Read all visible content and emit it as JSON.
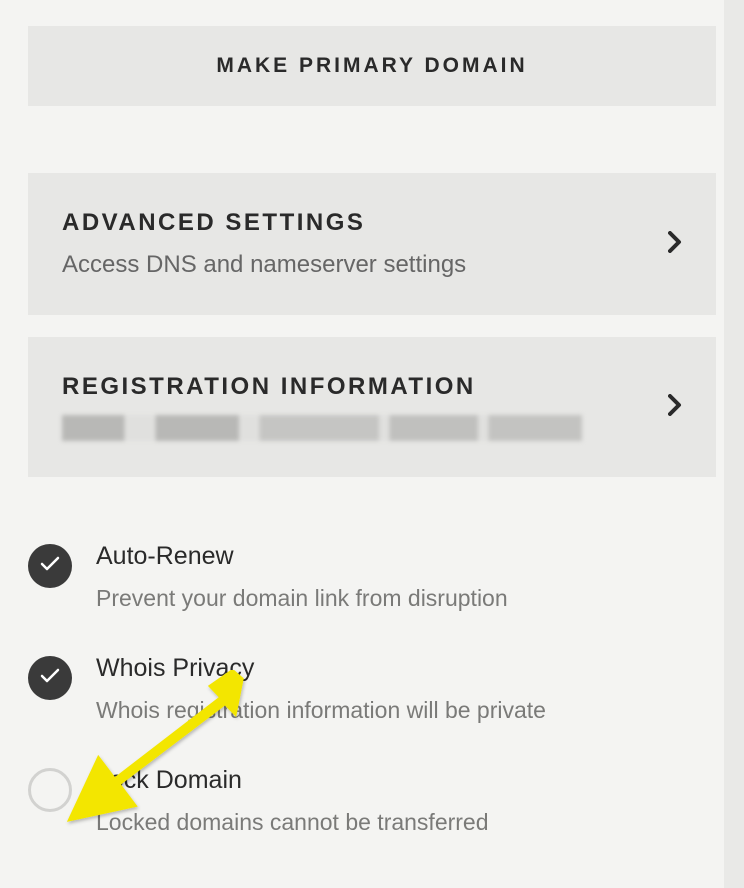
{
  "primaryButton": {
    "label": "MAKE PRIMARY DOMAIN"
  },
  "cards": {
    "advanced": {
      "title": "ADVANCED SETTINGS",
      "desc": "Access DNS and nameserver settings"
    },
    "registration": {
      "title": "REGISTRATION INFORMATION"
    }
  },
  "toggles": {
    "autoRenew": {
      "title": "Auto-Renew",
      "desc": "Prevent your domain link from disruption",
      "enabled": true
    },
    "whois": {
      "title": "Whois Privacy",
      "desc": "Whois registration information will be private",
      "enabled": true
    },
    "lock": {
      "title": "Lock Domain",
      "desc": "Locked domains cannot be transferred",
      "enabled": false
    }
  }
}
